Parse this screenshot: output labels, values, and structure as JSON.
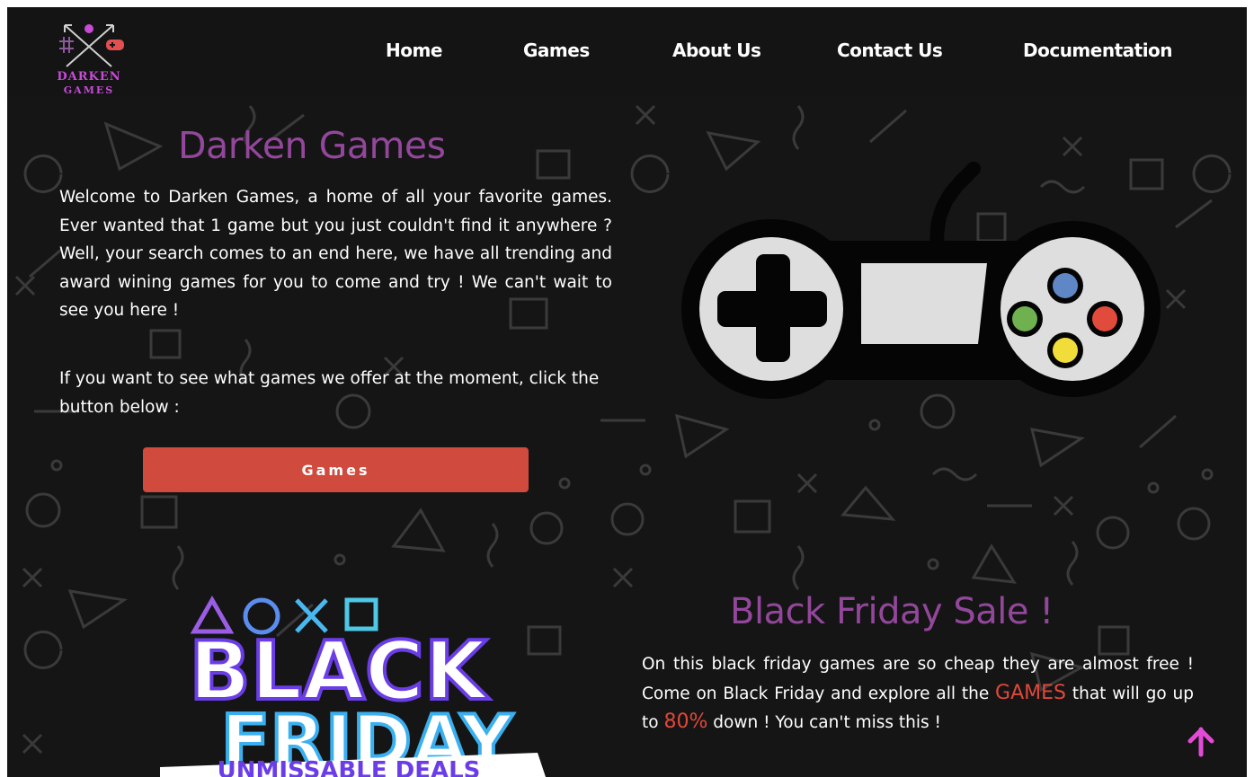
{
  "nav": {
    "logo_line1": "DARKEN",
    "logo_line2": "GAMES",
    "links": [
      "Home",
      "Games",
      "About Us",
      "Contact Us",
      "Documentation"
    ]
  },
  "hero": {
    "title": "Darken Games",
    "paragraph1": "Welcome to Darken Games, a home of all your favorite games. Ever wanted that 1 game but you just couldn't find it anywhere ? Well, your search comes to an end here, we have all trending and award wining games for you to come and try ! We can't wait to see you here !",
    "paragraph2": "If you want to see what games we offer at the moment, click the button below :",
    "button_label": "Games"
  },
  "black_friday": {
    "title": "Black Friday Sale !",
    "text_before": "On this black friday games are so cheap they are almost free ! Come on Black Friday and explore all the",
    "highlight_games": "GAMES",
    "text_middle": "that will go up to",
    "highlight_percent": "80%",
    "text_after": "down ! You can't miss this !",
    "art_line1": "BLACK",
    "art_line2": "FRIDAY",
    "art_banner": "UNMISSABLE DEALS"
  },
  "colors": {
    "background": "#151515",
    "accent_purple": "#93479b",
    "logo_magenta": "#c74bd7",
    "button_red": "#d04a3d",
    "highlight_red": "#e0483a",
    "scroll_top_pink": "#e24bd6"
  },
  "icons": {
    "scroll_top": "arrow-up-icon",
    "controller": "game-controller-icon"
  }
}
